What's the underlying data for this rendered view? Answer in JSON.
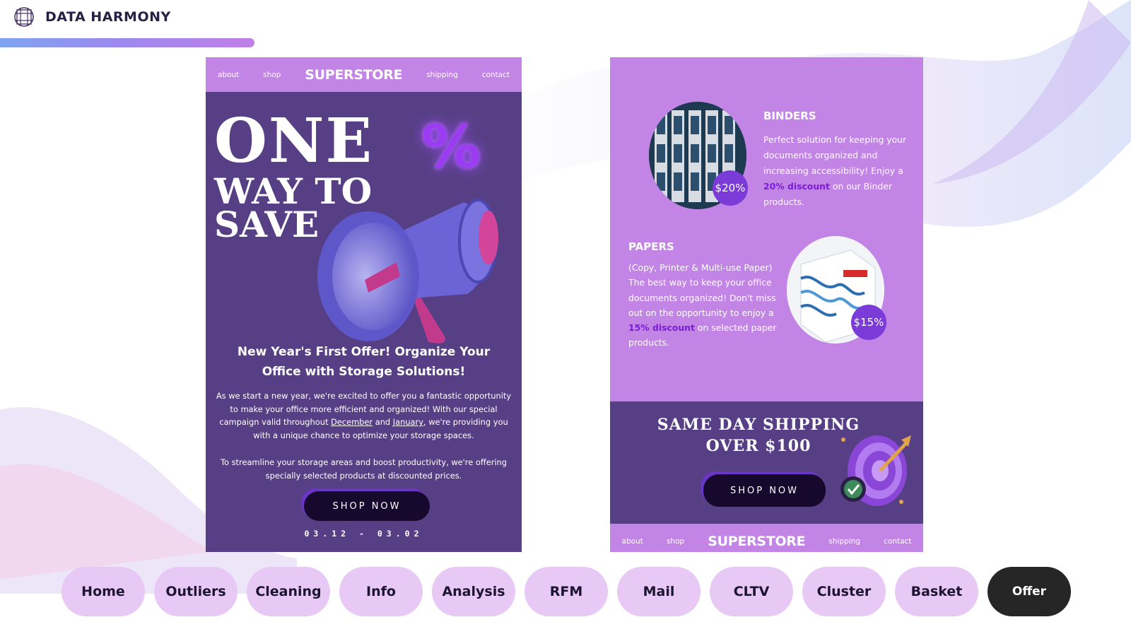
{
  "brand": {
    "name": "DATA HARMONY",
    "logo_icon": "globe-grid-icon"
  },
  "left_email": {
    "nav": {
      "about": "about",
      "shop": "shop",
      "logo": "SUPERSTORE",
      "shipping": "shipping",
      "contact": "contact"
    },
    "hero": {
      "line1": "ONE",
      "line2": "WAY TO",
      "line3": "SAVE",
      "percent": "%"
    },
    "headline": "New Year's First Offer! Organize Your Office with Storage Solutions!",
    "body1_part1": "As we start a new year, we're excited to offer you a fantastic opportunity to make your office more efficient and organized! With our special campaign valid throughout ",
    "body1_december": "December",
    "body1_and": " and ",
    "body1_january": "January",
    "body1_part2": ", we're providing you with a unique chance to optimize your storage spaces.",
    "body2": "To streamline your storage areas and boost productivity, we're offering specially selected products at discounted prices.",
    "button": "SHOP NOW",
    "dates": "03.12 - 03.02"
  },
  "right_email": {
    "binders": {
      "title": "BINDERS",
      "desc_part1": "Perfect solution for keeping your documents organized and increasing accessibility! Enjoy a ",
      "desc_highlight": "20% discount",
      "desc_part2": " on our Binder products.",
      "badge": "$20%"
    },
    "papers": {
      "title": "PAPERS",
      "desc_part1": "(Copy, Printer & Multi-use Paper) The best way to keep your office documents organized! Don't miss out on the opportunity to enjoy a ",
      "desc_highlight": "15% discount",
      "desc_part2": " on selected paper products.",
      "badge": "$15%"
    },
    "shipping": {
      "line1": "SAME DAY SHIPPING",
      "line2": "OVER $100"
    },
    "button": "SHOP NOW",
    "nav": {
      "about": "about",
      "shop": "shop",
      "logo": "SUPERSTORE",
      "shipping": "shipping",
      "contact": "contact"
    }
  },
  "slide_nav": [
    "Home",
    "Outliers",
    "Cleaning",
    "Info",
    "Analysis",
    "RFM",
    "Mail",
    "CLTV",
    "Cluster",
    "Basket",
    "Offer"
  ],
  "active_slide": "Offer",
  "colors": {
    "panel_dark": "#573f85",
    "panel_light": "#c285e6",
    "pill": "#e8c8f5",
    "pill_active": "#262626",
    "highlight": "#7a1bd8"
  }
}
